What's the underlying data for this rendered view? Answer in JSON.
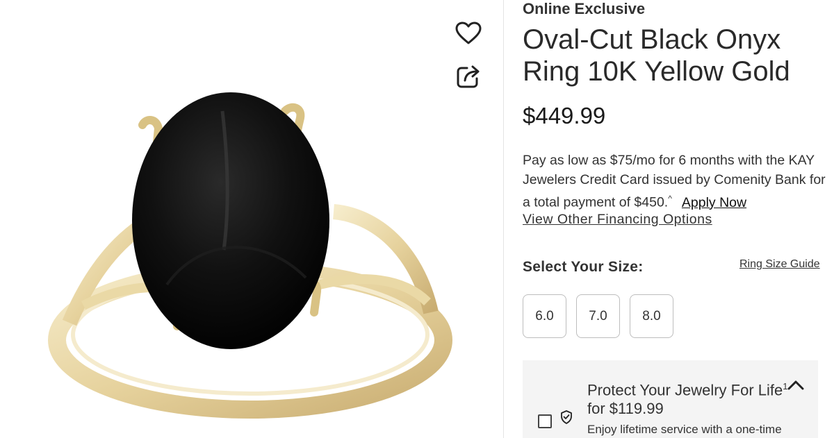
{
  "product": {
    "eyebrow": "Online Exclusive",
    "title": "Oval-Cut Black Onyx Ring 10K Yellow Gold",
    "price": "$449.99"
  },
  "financing": {
    "text": "Pay as low as $75/mo for 6 months with the KAY Jewelers Credit Card issued by Comenity Bank for a total payment of $450.",
    "footnote_mark": "^",
    "apply_label": "Apply Now",
    "other_options_label": "View Other Financing Options"
  },
  "size_selector": {
    "label": "Select Your Size:",
    "guide_label": "Ring Size Guide",
    "options": [
      "6.0",
      "7.0",
      "8.0"
    ]
  },
  "protection": {
    "title": "Protect Your Jewelry For Life",
    "footnote_mark": "1",
    "price": "for $119.99",
    "description": "Enjoy lifetime service with a one-time"
  },
  "icons": {
    "favorite": "heart-icon",
    "share": "share-icon",
    "shield": "shield-check-icon",
    "collapse": "chevron-up-icon"
  },
  "colors": {
    "gold_light": "#f1e2b4",
    "gold_dark": "#c9ad72",
    "onyx": "#0b0b0b",
    "panel_bg": "#f4f4f4"
  }
}
